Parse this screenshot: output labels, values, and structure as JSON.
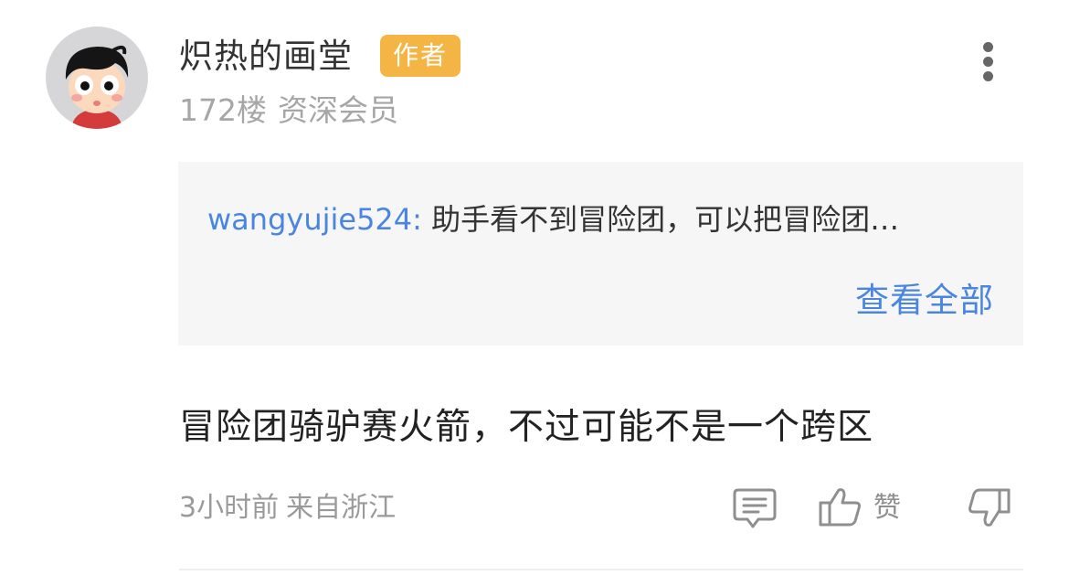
{
  "post": {
    "username": "炽热的画堂",
    "author_badge": "作者",
    "floor": "172楼",
    "member_level": "资深会员",
    "quote": {
      "user": "wangyujie524:",
      "text": "助手看不到冒险团，可以把冒险团…",
      "view_all": "查看全部"
    },
    "content": "冒险团骑驴赛火箭，不过可能不是一个跨区",
    "time": "3小时前",
    "location": "来自浙江",
    "actions": {
      "comment_icon": "comment-icon",
      "like_icon": "thumbs-up-icon",
      "like_label": "赞",
      "dislike_icon": "thumbs-down-icon"
    },
    "colors": {
      "badge": "#f5b544",
      "link": "#4a86e0",
      "muted": "#a6a6a6"
    }
  }
}
